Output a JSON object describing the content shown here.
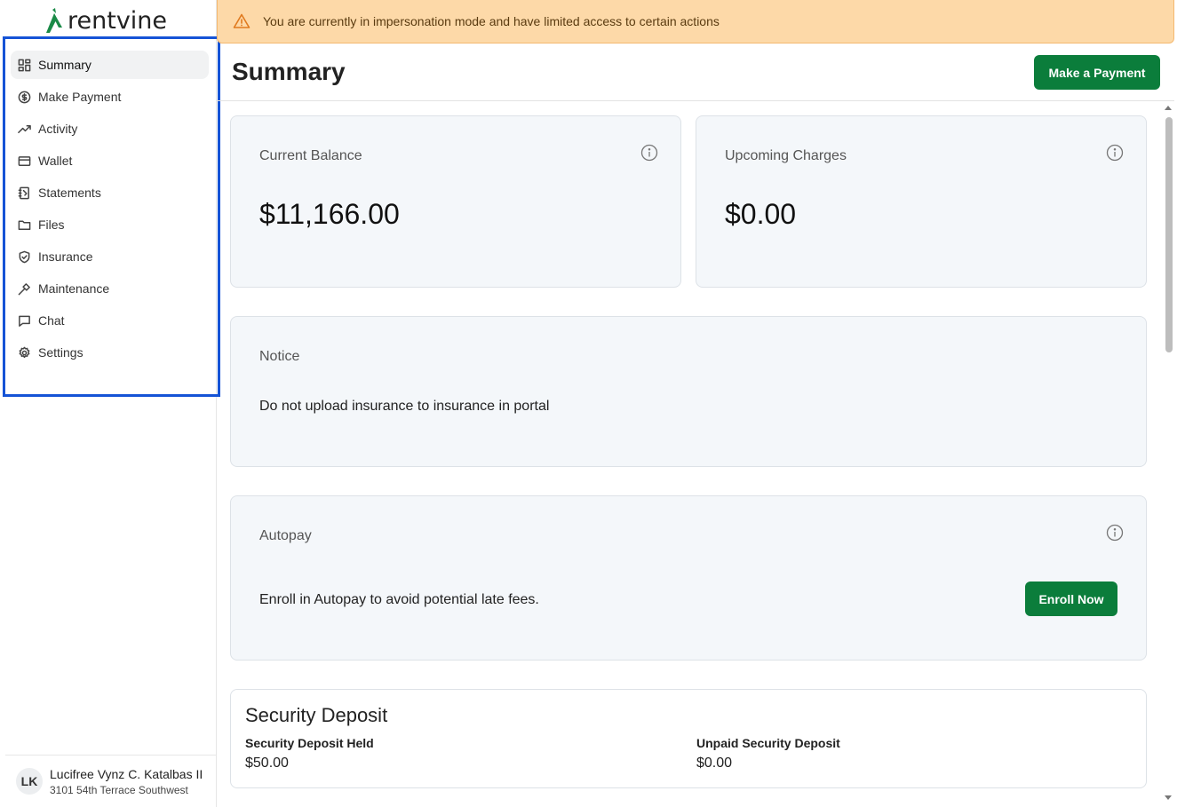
{
  "brand": {
    "name": "rentvine",
    "color": "#1a8a47"
  },
  "sidebar": {
    "items": [
      {
        "label": "Summary",
        "icon": "grid-icon",
        "active": true
      },
      {
        "label": "Make Payment",
        "icon": "dollar-circle-icon"
      },
      {
        "label": "Activity",
        "icon": "trend-up-icon"
      },
      {
        "label": "Wallet",
        "icon": "card-icon"
      },
      {
        "label": "Statements",
        "icon": "notebook-icon"
      },
      {
        "label": "Files",
        "icon": "folder-icon"
      },
      {
        "label": "Insurance",
        "icon": "shield-icon"
      },
      {
        "label": "Maintenance",
        "icon": "hammer-icon"
      },
      {
        "label": "Chat",
        "icon": "chat-icon"
      },
      {
        "label": "Settings",
        "icon": "gear-icon"
      }
    ]
  },
  "user": {
    "initials": "LK",
    "name": "Lucifree Vynz C. Katalbas II",
    "address": "3101 54th Terrace Southwest"
  },
  "banner": {
    "text": "You are currently in impersonation mode and have limited access to certain actions"
  },
  "header": {
    "title": "Summary",
    "pay_button": "Make a Payment"
  },
  "cards": {
    "current_balance": {
      "label": "Current Balance",
      "amount": "$11,166.00"
    },
    "upcoming_charges": {
      "label": "Upcoming Charges",
      "amount": "$0.00"
    },
    "notice": {
      "label": "Notice",
      "text": "Do not upload insurance to insurance in portal"
    },
    "autopay": {
      "label": "Autopay",
      "text": "Enroll in Autopay to avoid potential late fees.",
      "button": "Enroll Now"
    }
  },
  "deposit": {
    "title": "Security Deposit",
    "held_label": "Security Deposit Held",
    "held_value": "$50.00",
    "unpaid_label": "Unpaid Security Deposit",
    "unpaid_value": "$0.00"
  },
  "colors": {
    "accent_green": "#0b7d3b",
    "banner_bg": "#fdd9a8",
    "highlight_border": "#1553d6"
  }
}
